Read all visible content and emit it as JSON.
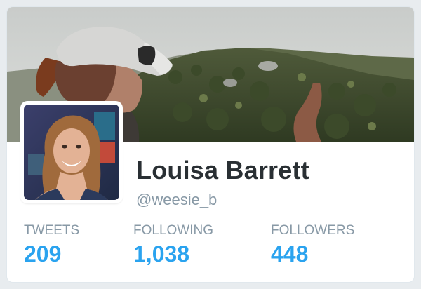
{
  "profile": {
    "name": "Louisa Barrett",
    "handle": "@weesie_b"
  },
  "stats": {
    "tweets": {
      "label": "TWEETS",
      "value": "209"
    },
    "following": {
      "label": "FOLLOWING",
      "value": "1,038"
    },
    "followers": {
      "label": "FOLLOWERS",
      "value": "448"
    }
  },
  "colors": {
    "accent": "#2aa3ef",
    "name": "#292f33",
    "muted": "#8899a6"
  }
}
